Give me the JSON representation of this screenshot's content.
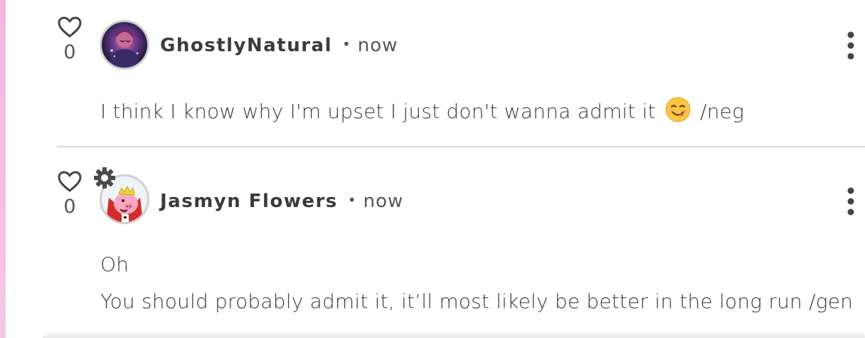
{
  "comments": [
    {
      "username": "GhostlyNatural",
      "time": "now",
      "likes": "0",
      "avatar_icon": "user-avatar-icon",
      "text_before_emoji": "I think I know why I'm upset I just don't wanna admit it",
      "emoji_icon": "face-savoring-food-emoji-icon",
      "text_after_emoji": "/neg"
    },
    {
      "username": "Jasmyn Flowers",
      "time": "now",
      "likes": "0",
      "avatar_icon": "crowned-pig-avatar-icon",
      "moderator_badge_icon": "gear-badge-icon",
      "lines": [
        "Oh",
        "You should probably admit it, it’ll most likely be better in the long run /gen"
      ]
    }
  ],
  "separator": "•",
  "colors": {
    "accent_stripe": "#f3b6df",
    "text": "#3d3d3d",
    "divider": "#d9d9d9"
  }
}
